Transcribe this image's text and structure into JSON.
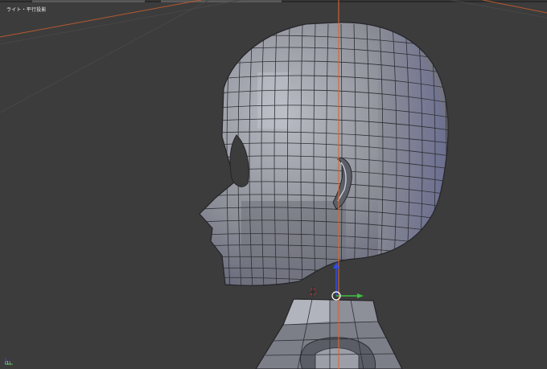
{
  "viewport": {
    "view_label": "ライト・平行投影",
    "object_label": "(1) ",
    "colors": {
      "background": "#3c3c3c",
      "grid_line": "#464646",
      "z_axis": "#d86a2a",
      "mesh_face": "#8b8d95",
      "mesh_edge": "#2e2e33",
      "gizmo_z": "#2e4de0",
      "gizmo_y": "#3fbf3f",
      "gizmo_ring": "#ffffff"
    }
  }
}
